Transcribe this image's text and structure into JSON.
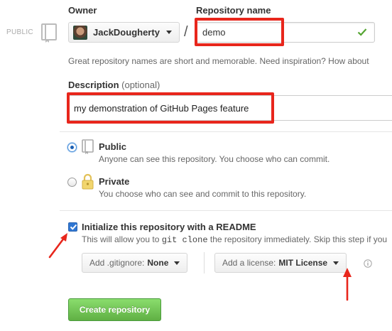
{
  "visibility_badge": "PUBLIC",
  "owner": {
    "label": "Owner",
    "name": "JackDougherty"
  },
  "separator": "/",
  "repository": {
    "label": "Repository name",
    "value": "demo"
  },
  "hint": "Great repository names are short and memorable. Need inspiration? How about",
  "description": {
    "label": "Description",
    "optional": "(optional)",
    "value": "my demonstration of GitHub Pages feature"
  },
  "visibility": {
    "public": {
      "title": "Public",
      "desc": "Anyone can see this repository. You choose who can commit.",
      "selected": true
    },
    "private": {
      "title": "Private",
      "desc": "You choose who can see and commit to this repository.",
      "selected": false
    }
  },
  "readme": {
    "title": "Initialize this repository with a README",
    "checked": true,
    "desc_before": "This will allow you to",
    "desc_code": "git clone",
    "desc_after": "the repository immediately. Skip this step if you"
  },
  "gitignore": {
    "label": "Add .gitignore:",
    "value": "None"
  },
  "license": {
    "label": "Add a license:",
    "value": "MIT License"
  },
  "create_button": "Create repository",
  "colors": {
    "highlight": "#e8261c",
    "create_green": "#60b044",
    "check_green": "#55a532"
  }
}
